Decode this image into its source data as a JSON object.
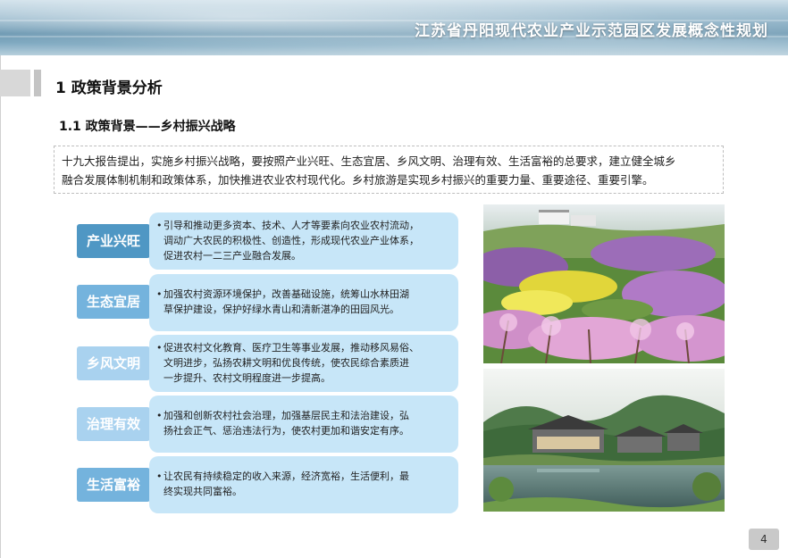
{
  "header": {
    "title": "江苏省丹阳现代农业产业示范园区发展概念性规划"
  },
  "section": {
    "title": "1  政策背景分析"
  },
  "subsection": {
    "title": "1.1  政策背景——乡村振兴战略"
  },
  "intro": {
    "line1": "十九大报告提出，实施乡村振兴战略，要按照产业兴旺、生态宜居、乡风文明、治理有效、生活富裕的总要求，建立健全城乡",
    "line2": "融合发展体制机制和政策体系，加快推进农业农村现代化。乡村旅游是实现乡村振兴的重要力量、重要途径、重要引擎。"
  },
  "items": [
    {
      "label": "产业兴旺",
      "color": "#4f97c4",
      "desc": [
        "引导和推动更多资本、技术、人才等要素向农业农村流动，",
        "调动广大农民的积极性、创造性，形成现代农业产业体系，",
        "促进农村一二三产业融合发展。"
      ]
    },
    {
      "label": "生态宜居",
      "color": "#74b3dd",
      "desc": [
        "加强农村资源环境保护，改善基础设施，统筹山水林田湖",
        "草保护建设，保护好绿水青山和清新湛净的田园风光。"
      ]
    },
    {
      "label": "乡风文明",
      "color": "#a9d2ef",
      "desc": [
        "促进农村文化教育、医疗卫生等事业发展，推动移风易俗、",
        "文明进步，弘扬农耕文明和优良传统，使农民综合素质进",
        "一步提升、农村文明程度进一步提高。"
      ]
    },
    {
      "label": "治理有效",
      "color": "#a9d2ef",
      "desc": [
        "加强和创新农村社会治理，加强基层民主和法治建设，弘",
        "扬社会正气、惩治违法行为，使农村更加和谐安定有序。"
      ]
    },
    {
      "label": "生活富裕",
      "color": "#74b3dd",
      "desc": [
        "让农民有持续稳定的收入来源，经济宽裕，生活便利，最",
        "终实现共同富裕。"
      ]
    }
  ],
  "bullet": "•",
  "page": {
    "number": "4"
  }
}
